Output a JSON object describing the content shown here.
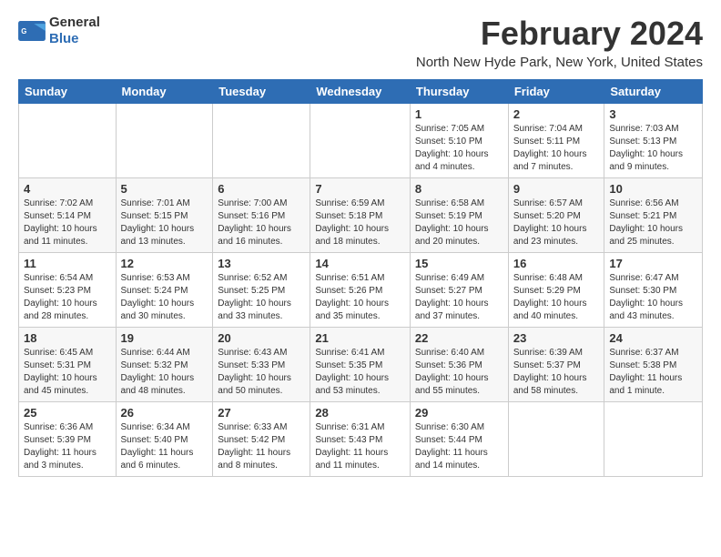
{
  "header": {
    "logo_general": "General",
    "logo_blue": "Blue",
    "title": "February 2024",
    "subtitle": "North New Hyde Park, New York, United States"
  },
  "calendar": {
    "columns": [
      "Sunday",
      "Monday",
      "Tuesday",
      "Wednesday",
      "Thursday",
      "Friday",
      "Saturday"
    ],
    "rows": [
      [
        {
          "day": "",
          "info": ""
        },
        {
          "day": "",
          "info": ""
        },
        {
          "day": "",
          "info": ""
        },
        {
          "day": "",
          "info": ""
        },
        {
          "day": "1",
          "info": "Sunrise: 7:05 AM\nSunset: 5:10 PM\nDaylight: 10 hours\nand 4 minutes."
        },
        {
          "day": "2",
          "info": "Sunrise: 7:04 AM\nSunset: 5:11 PM\nDaylight: 10 hours\nand 7 minutes."
        },
        {
          "day": "3",
          "info": "Sunrise: 7:03 AM\nSunset: 5:13 PM\nDaylight: 10 hours\nand 9 minutes."
        }
      ],
      [
        {
          "day": "4",
          "info": "Sunrise: 7:02 AM\nSunset: 5:14 PM\nDaylight: 10 hours\nand 11 minutes."
        },
        {
          "day": "5",
          "info": "Sunrise: 7:01 AM\nSunset: 5:15 PM\nDaylight: 10 hours\nand 13 minutes."
        },
        {
          "day": "6",
          "info": "Sunrise: 7:00 AM\nSunset: 5:16 PM\nDaylight: 10 hours\nand 16 minutes."
        },
        {
          "day": "7",
          "info": "Sunrise: 6:59 AM\nSunset: 5:18 PM\nDaylight: 10 hours\nand 18 minutes."
        },
        {
          "day": "8",
          "info": "Sunrise: 6:58 AM\nSunset: 5:19 PM\nDaylight: 10 hours\nand 20 minutes."
        },
        {
          "day": "9",
          "info": "Sunrise: 6:57 AM\nSunset: 5:20 PM\nDaylight: 10 hours\nand 23 minutes."
        },
        {
          "day": "10",
          "info": "Sunrise: 6:56 AM\nSunset: 5:21 PM\nDaylight: 10 hours\nand 25 minutes."
        }
      ],
      [
        {
          "day": "11",
          "info": "Sunrise: 6:54 AM\nSunset: 5:23 PM\nDaylight: 10 hours\nand 28 minutes."
        },
        {
          "day": "12",
          "info": "Sunrise: 6:53 AM\nSunset: 5:24 PM\nDaylight: 10 hours\nand 30 minutes."
        },
        {
          "day": "13",
          "info": "Sunrise: 6:52 AM\nSunset: 5:25 PM\nDaylight: 10 hours\nand 33 minutes."
        },
        {
          "day": "14",
          "info": "Sunrise: 6:51 AM\nSunset: 5:26 PM\nDaylight: 10 hours\nand 35 minutes."
        },
        {
          "day": "15",
          "info": "Sunrise: 6:49 AM\nSunset: 5:27 PM\nDaylight: 10 hours\nand 37 minutes."
        },
        {
          "day": "16",
          "info": "Sunrise: 6:48 AM\nSunset: 5:29 PM\nDaylight: 10 hours\nand 40 minutes."
        },
        {
          "day": "17",
          "info": "Sunrise: 6:47 AM\nSunset: 5:30 PM\nDaylight: 10 hours\nand 43 minutes."
        }
      ],
      [
        {
          "day": "18",
          "info": "Sunrise: 6:45 AM\nSunset: 5:31 PM\nDaylight: 10 hours\nand 45 minutes."
        },
        {
          "day": "19",
          "info": "Sunrise: 6:44 AM\nSunset: 5:32 PM\nDaylight: 10 hours\nand 48 minutes."
        },
        {
          "day": "20",
          "info": "Sunrise: 6:43 AM\nSunset: 5:33 PM\nDaylight: 10 hours\nand 50 minutes."
        },
        {
          "day": "21",
          "info": "Sunrise: 6:41 AM\nSunset: 5:35 PM\nDaylight: 10 hours\nand 53 minutes."
        },
        {
          "day": "22",
          "info": "Sunrise: 6:40 AM\nSunset: 5:36 PM\nDaylight: 10 hours\nand 55 minutes."
        },
        {
          "day": "23",
          "info": "Sunrise: 6:39 AM\nSunset: 5:37 PM\nDaylight: 10 hours\nand 58 minutes."
        },
        {
          "day": "24",
          "info": "Sunrise: 6:37 AM\nSunset: 5:38 PM\nDaylight: 11 hours\nand 1 minute."
        }
      ],
      [
        {
          "day": "25",
          "info": "Sunrise: 6:36 AM\nSunset: 5:39 PM\nDaylight: 11 hours\nand 3 minutes."
        },
        {
          "day": "26",
          "info": "Sunrise: 6:34 AM\nSunset: 5:40 PM\nDaylight: 11 hours\nand 6 minutes."
        },
        {
          "day": "27",
          "info": "Sunrise: 6:33 AM\nSunset: 5:42 PM\nDaylight: 11 hours\nand 8 minutes."
        },
        {
          "day": "28",
          "info": "Sunrise: 6:31 AM\nSunset: 5:43 PM\nDaylight: 11 hours\nand 11 minutes."
        },
        {
          "day": "29",
          "info": "Sunrise: 6:30 AM\nSunset: 5:44 PM\nDaylight: 11 hours\nand 14 minutes."
        },
        {
          "day": "",
          "info": ""
        },
        {
          "day": "",
          "info": ""
        }
      ]
    ]
  }
}
